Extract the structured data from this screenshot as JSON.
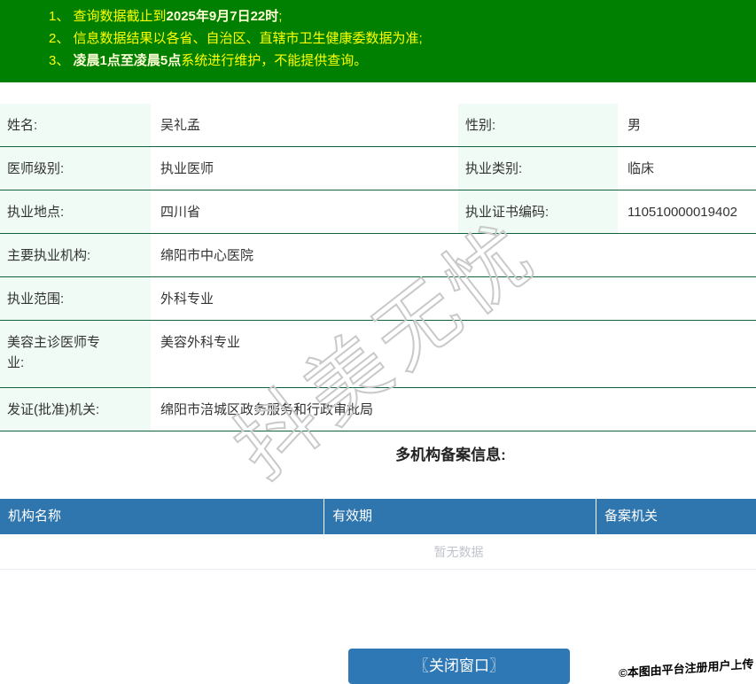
{
  "banner": {
    "lines": [
      {
        "prefix": "1、 查询数据截止到",
        "bold": "2025年9月7日22时",
        "suffix": ";"
      },
      {
        "prefix": "2、 信息数据结果以各省、自治区、直辖市卫生健康委数据为准;",
        "bold": "",
        "suffix": ""
      },
      {
        "prefix": "3、 ",
        "bold": "凌晨1点至凌晨5点",
        "suffix": "系统进行维护，不能提供查询。"
      }
    ]
  },
  "info": {
    "r1": {
      "l1": "姓名:",
      "v1": "吴礼孟",
      "l2": "性别:",
      "v2": "男"
    },
    "r2": {
      "l1": "医师级别:",
      "v1": "执业医师",
      "l2": "执业类别:",
      "v2": "临床"
    },
    "r3": {
      "l1": "执业地点:",
      "v1": "四川省",
      "l2": "执业证书编码:",
      "v2": "110510000019402"
    },
    "r4": {
      "l": "主要执业机构:",
      "v": "绵阳市中心医院"
    },
    "r5": {
      "l": "执业范围:",
      "v": "外科专业"
    },
    "r6": {
      "l": "美容主诊医师专业:",
      "v": "美容外科专业"
    },
    "r7": {
      "l": "发证(批准)机关:",
      "v": "绵阳市涪城区政务服务和行政审批局"
    }
  },
  "records": {
    "title": "多机构备案信息:",
    "headers": [
      "机构名称",
      "有效期",
      "备案机关"
    ],
    "empty": "暂无数据"
  },
  "footer": {
    "close_button": "〖关闭窗口〗",
    "stamp": "©本图由平台注册用户上传"
  },
  "watermark": {
    "text": "抖美无忧"
  },
  "colors": {
    "banner_bg": "#008000",
    "banner_text": "#ffff00",
    "banner_bold_text": "#ffffd6",
    "label_bg": "#effbf4",
    "table_border": "#11613d",
    "record_header_bg": "#2f75ae",
    "button_bg": "#2e78b5",
    "empty_text": "#c0c4cc"
  }
}
